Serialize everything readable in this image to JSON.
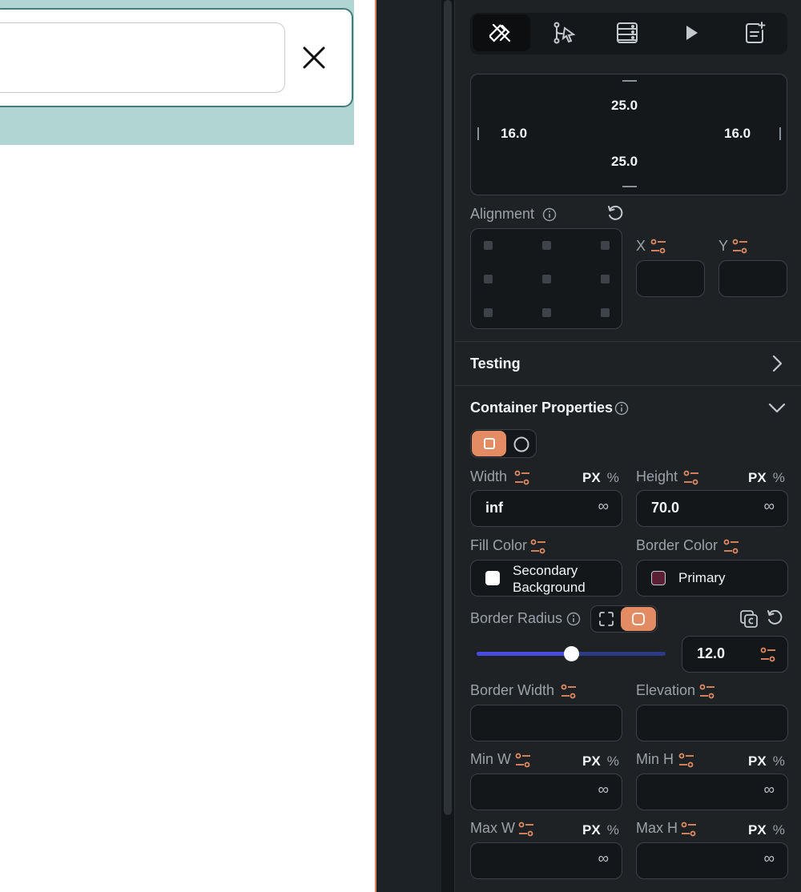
{
  "padding": {
    "top": "25.0",
    "bottom": "25.0",
    "left": "16.0",
    "right": "16.0"
  },
  "alignment": {
    "label": "Alignment",
    "x_label": "X",
    "y_label": "Y",
    "x_value": "",
    "y_value": ""
  },
  "testing": {
    "title": "Testing"
  },
  "container": {
    "title": "Container Properties",
    "width": {
      "label": "Width",
      "value": "inf",
      "unit_px": "PX",
      "unit_pct": "%"
    },
    "height": {
      "label": "Height",
      "value": "70.0",
      "unit_px": "PX",
      "unit_pct": "%"
    },
    "fill_color": {
      "label": "Fill Color",
      "line1": "Secondary",
      "line2": "Background",
      "swatch": "#ffffff"
    },
    "border_color": {
      "label": "Border Color",
      "value": "Primary",
      "swatch": "#5a1f32"
    },
    "border_radius": {
      "label": "Border Radius",
      "value": "12.0",
      "slider_fraction": 0.5
    },
    "border_width": {
      "label": "Border Width",
      "value": ""
    },
    "elevation": {
      "label": "Elevation",
      "value": ""
    },
    "min_w": {
      "label": "Min W",
      "unit_px": "PX",
      "unit_pct": "%"
    },
    "min_h": {
      "label": "Min H",
      "unit_px": "PX",
      "unit_pct": "%"
    },
    "max_w": {
      "label": "Max W",
      "unit_px": "PX",
      "unit_pct": "%"
    },
    "max_h": {
      "label": "Max H",
      "unit_px": "PX",
      "unit_pct": "%"
    },
    "infinity": "∞"
  },
  "colors": {
    "accent": "#e38c64",
    "panel_bg": "#1e2225",
    "canvas_selection": "#b1d6d1",
    "slider": "#4a4ae0"
  },
  "icons": [
    "design-tools-icon",
    "logic-flow-icon",
    "backend-query-icon",
    "play-icon",
    "add-note-icon",
    "close-icon",
    "info-icon",
    "reset-icon",
    "options-icon",
    "chevron-right-icon",
    "chevron-down-icon",
    "copy-icon"
  ]
}
